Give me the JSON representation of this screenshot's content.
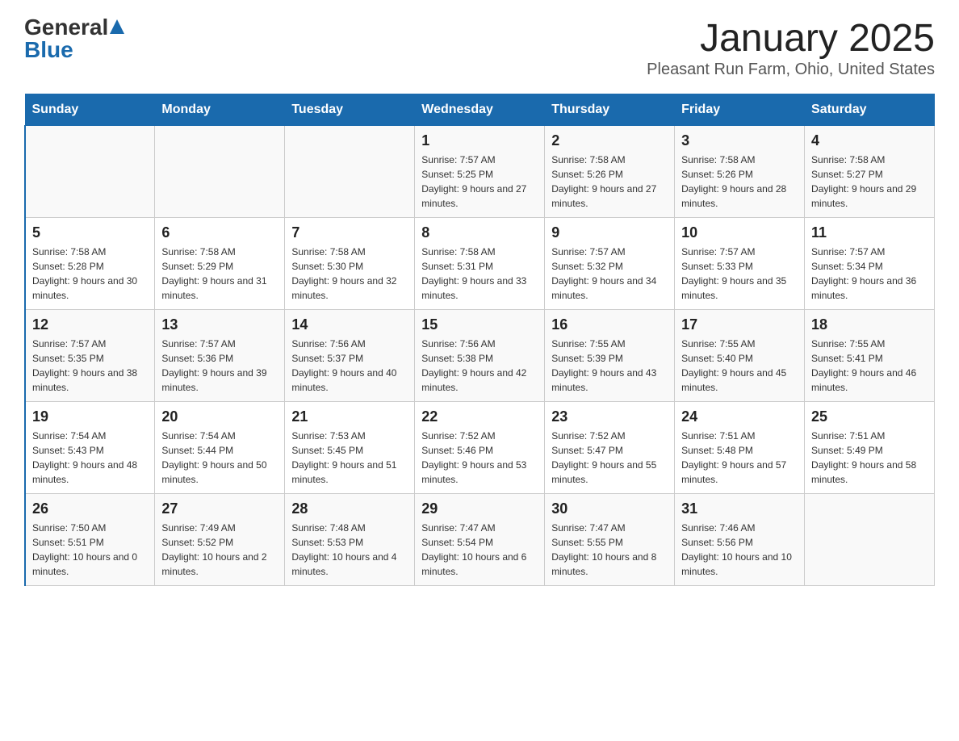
{
  "header": {
    "logo_general": "General",
    "logo_blue": "Blue",
    "month_title": "January 2025",
    "location": "Pleasant Run Farm, Ohio, United States"
  },
  "days_of_week": [
    "Sunday",
    "Monday",
    "Tuesday",
    "Wednesday",
    "Thursday",
    "Friday",
    "Saturday"
  ],
  "weeks": [
    [
      {
        "day": "",
        "sunrise": "",
        "sunset": "",
        "daylight": ""
      },
      {
        "day": "",
        "sunrise": "",
        "sunset": "",
        "daylight": ""
      },
      {
        "day": "",
        "sunrise": "",
        "sunset": "",
        "daylight": ""
      },
      {
        "day": "1",
        "sunrise": "Sunrise: 7:57 AM",
        "sunset": "Sunset: 5:25 PM",
        "daylight": "Daylight: 9 hours and 27 minutes."
      },
      {
        "day": "2",
        "sunrise": "Sunrise: 7:58 AM",
        "sunset": "Sunset: 5:26 PM",
        "daylight": "Daylight: 9 hours and 27 minutes."
      },
      {
        "day": "3",
        "sunrise": "Sunrise: 7:58 AM",
        "sunset": "Sunset: 5:26 PM",
        "daylight": "Daylight: 9 hours and 28 minutes."
      },
      {
        "day": "4",
        "sunrise": "Sunrise: 7:58 AM",
        "sunset": "Sunset: 5:27 PM",
        "daylight": "Daylight: 9 hours and 29 minutes."
      }
    ],
    [
      {
        "day": "5",
        "sunrise": "Sunrise: 7:58 AM",
        "sunset": "Sunset: 5:28 PM",
        "daylight": "Daylight: 9 hours and 30 minutes."
      },
      {
        "day": "6",
        "sunrise": "Sunrise: 7:58 AM",
        "sunset": "Sunset: 5:29 PM",
        "daylight": "Daylight: 9 hours and 31 minutes."
      },
      {
        "day": "7",
        "sunrise": "Sunrise: 7:58 AM",
        "sunset": "Sunset: 5:30 PM",
        "daylight": "Daylight: 9 hours and 32 minutes."
      },
      {
        "day": "8",
        "sunrise": "Sunrise: 7:58 AM",
        "sunset": "Sunset: 5:31 PM",
        "daylight": "Daylight: 9 hours and 33 minutes."
      },
      {
        "day": "9",
        "sunrise": "Sunrise: 7:57 AM",
        "sunset": "Sunset: 5:32 PM",
        "daylight": "Daylight: 9 hours and 34 minutes."
      },
      {
        "day": "10",
        "sunrise": "Sunrise: 7:57 AM",
        "sunset": "Sunset: 5:33 PM",
        "daylight": "Daylight: 9 hours and 35 minutes."
      },
      {
        "day": "11",
        "sunrise": "Sunrise: 7:57 AM",
        "sunset": "Sunset: 5:34 PM",
        "daylight": "Daylight: 9 hours and 36 minutes."
      }
    ],
    [
      {
        "day": "12",
        "sunrise": "Sunrise: 7:57 AM",
        "sunset": "Sunset: 5:35 PM",
        "daylight": "Daylight: 9 hours and 38 minutes."
      },
      {
        "day": "13",
        "sunrise": "Sunrise: 7:57 AM",
        "sunset": "Sunset: 5:36 PM",
        "daylight": "Daylight: 9 hours and 39 minutes."
      },
      {
        "day": "14",
        "sunrise": "Sunrise: 7:56 AM",
        "sunset": "Sunset: 5:37 PM",
        "daylight": "Daylight: 9 hours and 40 minutes."
      },
      {
        "day": "15",
        "sunrise": "Sunrise: 7:56 AM",
        "sunset": "Sunset: 5:38 PM",
        "daylight": "Daylight: 9 hours and 42 minutes."
      },
      {
        "day": "16",
        "sunrise": "Sunrise: 7:55 AM",
        "sunset": "Sunset: 5:39 PM",
        "daylight": "Daylight: 9 hours and 43 minutes."
      },
      {
        "day": "17",
        "sunrise": "Sunrise: 7:55 AM",
        "sunset": "Sunset: 5:40 PM",
        "daylight": "Daylight: 9 hours and 45 minutes."
      },
      {
        "day": "18",
        "sunrise": "Sunrise: 7:55 AM",
        "sunset": "Sunset: 5:41 PM",
        "daylight": "Daylight: 9 hours and 46 minutes."
      }
    ],
    [
      {
        "day": "19",
        "sunrise": "Sunrise: 7:54 AM",
        "sunset": "Sunset: 5:43 PM",
        "daylight": "Daylight: 9 hours and 48 minutes."
      },
      {
        "day": "20",
        "sunrise": "Sunrise: 7:54 AM",
        "sunset": "Sunset: 5:44 PM",
        "daylight": "Daylight: 9 hours and 50 minutes."
      },
      {
        "day": "21",
        "sunrise": "Sunrise: 7:53 AM",
        "sunset": "Sunset: 5:45 PM",
        "daylight": "Daylight: 9 hours and 51 minutes."
      },
      {
        "day": "22",
        "sunrise": "Sunrise: 7:52 AM",
        "sunset": "Sunset: 5:46 PM",
        "daylight": "Daylight: 9 hours and 53 minutes."
      },
      {
        "day": "23",
        "sunrise": "Sunrise: 7:52 AM",
        "sunset": "Sunset: 5:47 PM",
        "daylight": "Daylight: 9 hours and 55 minutes."
      },
      {
        "day": "24",
        "sunrise": "Sunrise: 7:51 AM",
        "sunset": "Sunset: 5:48 PM",
        "daylight": "Daylight: 9 hours and 57 minutes."
      },
      {
        "day": "25",
        "sunrise": "Sunrise: 7:51 AM",
        "sunset": "Sunset: 5:49 PM",
        "daylight": "Daylight: 9 hours and 58 minutes."
      }
    ],
    [
      {
        "day": "26",
        "sunrise": "Sunrise: 7:50 AM",
        "sunset": "Sunset: 5:51 PM",
        "daylight": "Daylight: 10 hours and 0 minutes."
      },
      {
        "day": "27",
        "sunrise": "Sunrise: 7:49 AM",
        "sunset": "Sunset: 5:52 PM",
        "daylight": "Daylight: 10 hours and 2 minutes."
      },
      {
        "day": "28",
        "sunrise": "Sunrise: 7:48 AM",
        "sunset": "Sunset: 5:53 PM",
        "daylight": "Daylight: 10 hours and 4 minutes."
      },
      {
        "day": "29",
        "sunrise": "Sunrise: 7:47 AM",
        "sunset": "Sunset: 5:54 PM",
        "daylight": "Daylight: 10 hours and 6 minutes."
      },
      {
        "day": "30",
        "sunrise": "Sunrise: 7:47 AM",
        "sunset": "Sunset: 5:55 PM",
        "daylight": "Daylight: 10 hours and 8 minutes."
      },
      {
        "day": "31",
        "sunrise": "Sunrise: 7:46 AM",
        "sunset": "Sunset: 5:56 PM",
        "daylight": "Daylight: 10 hours and 10 minutes."
      },
      {
        "day": "",
        "sunrise": "",
        "sunset": "",
        "daylight": ""
      }
    ]
  ]
}
